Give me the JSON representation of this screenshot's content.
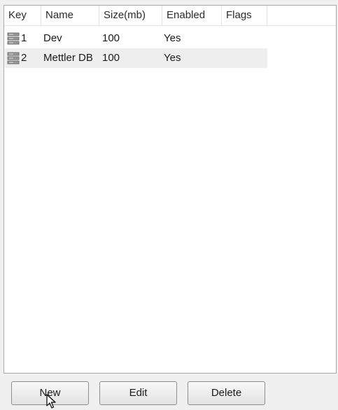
{
  "columns": [
    {
      "key": "key",
      "label": "Key"
    },
    {
      "key": "name",
      "label": "Name"
    },
    {
      "key": "size",
      "label": "Size(mb)"
    },
    {
      "key": "enabled",
      "label": "Enabled"
    },
    {
      "key": "flags",
      "label": "Flags"
    }
  ],
  "rows": [
    {
      "icon": "database-icon",
      "key": "1",
      "name": "Dev",
      "size": "100",
      "enabled": "Yes",
      "flags": ""
    },
    {
      "icon": "database-icon",
      "key": "2",
      "name": "Mettler DB",
      "size": "100",
      "enabled": "Yes",
      "flags": ""
    }
  ],
  "buttons": {
    "new_label": "New",
    "edit_label": "Edit",
    "delete_label": "Delete"
  },
  "cursor_icon": "mouse-pointer-icon"
}
